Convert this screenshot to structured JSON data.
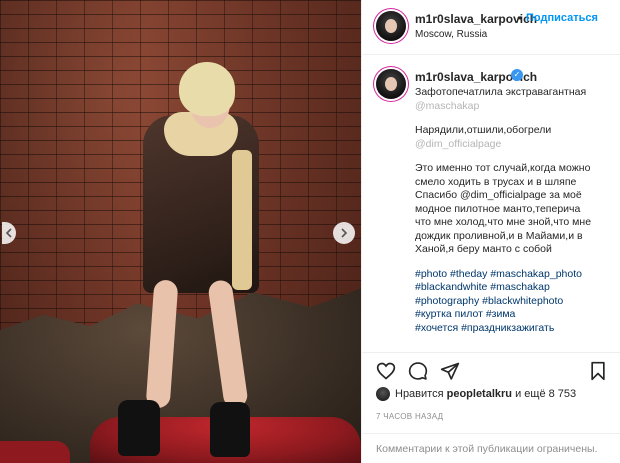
{
  "post_image": {
    "alt": ""
  },
  "header": {
    "username": "m1r0slava_karpovich",
    "separator": "•",
    "follow_label": "Подписаться",
    "location": "Moscow, Russia"
  },
  "caption": {
    "username": "m1r0slava_karpovich",
    "verified_icon": "check-badge-icon",
    "paragraphs": [
      {
        "lines": [
          "Зафотопечатлила экстравагантная",
          "@maschakap ⁣⁣⁣"
        ],
        "obscured_lines": [
          1
        ]
      },
      {
        "lines": [
          "Нарядили,отшили,обогрели",
          "@dim_officialpage ⁣⁣"
        ],
        "obscured_lines": [
          1
        ]
      },
      {
        "lines": [
          "Это именно тот случай,когда можно",
          "смело ходить в трусах и в шляпе⁣",
          "Спасибо @dim_officialpage за моё",
          "модное пилотное манто,теперича",
          "что мне холод,что мне зной,что мне",
          "дождик проливной,и в Майами,и в",
          "Ханой,я беру манто с собой⁣⁣⁣"
        ],
        "obscured_lines": []
      }
    ],
    "hashtags": [
      "#photo #theday #maschakap_photo",
      "#blackandwhite #maschakap",
      "#photography #blackwhitephoto",
      "#куртка пилот #зима",
      "#хочется #праздникзажигать ⁣"
    ]
  },
  "actions": {
    "like_icon": "heart-icon",
    "comment_icon": "comment-icon",
    "share_icon": "paper-plane-icon",
    "save_icon": "bookmark-icon"
  },
  "likes": {
    "prefix": "Нравится ",
    "user": "peopletalkru",
    "suffix": " и ещё 8 753"
  },
  "timestamp": "7 ЧАСОВ НАЗАД",
  "footer": {
    "comments_disabled": "Комментарии к этой публикации ограничены."
  }
}
